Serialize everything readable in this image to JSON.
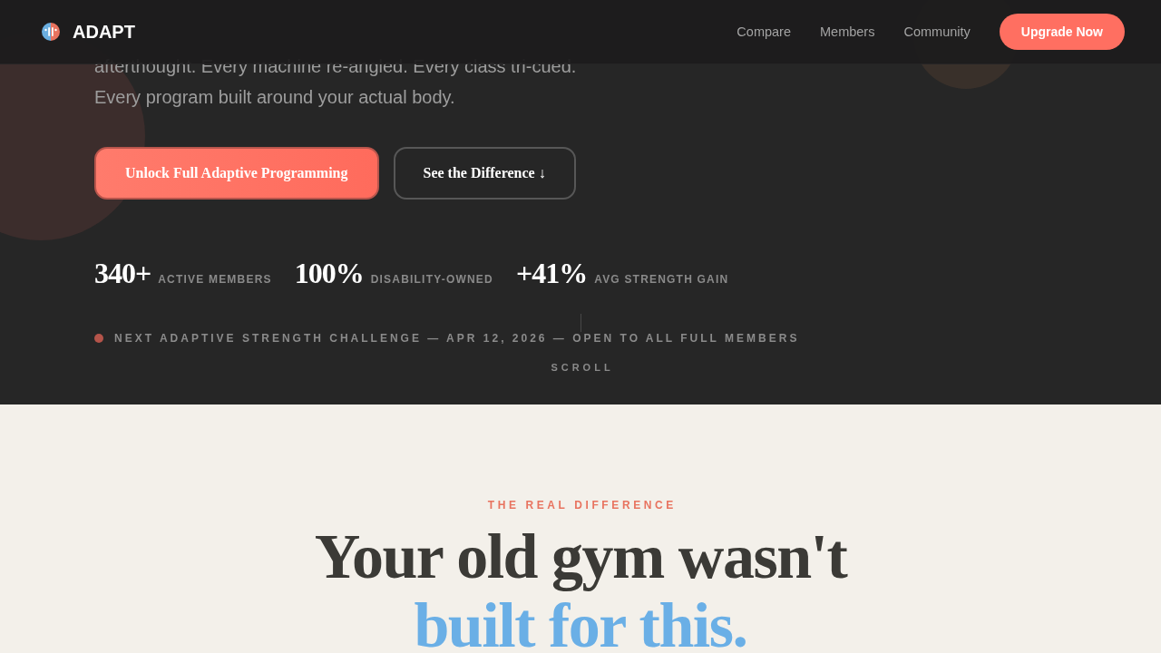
{
  "header": {
    "brand": "ADAPT",
    "nav": [
      "Compare",
      "Members",
      "Community"
    ],
    "cta": "Upgrade Now"
  },
  "hero": {
    "intro": "afterthought. Every machine re-angled. Every class tri-cued. Every program built around your actual body.",
    "buttons": [
      {
        "label": "Unlock Full Adaptive Programming",
        "kind": "primary"
      },
      {
        "label": "See the Difference ↓",
        "kind": "secondary"
      }
    ],
    "stats": [
      {
        "value": "340+",
        "label": "ACTIVE MEMBERS"
      },
      {
        "value": "100%",
        "label": "DISABILITY-OWNED"
      },
      {
        "value": "+41%",
        "label": "AVG STRENGTH GAIN"
      }
    ],
    "announcement": "NEXT ADAPTIVE STRENGTH CHALLENGE — APR 12, 2026 — OPEN TO ALL FULL MEMBERS",
    "scroll_hint": "SCROLL"
  },
  "difference": {
    "eyebrow": "THE REAL DIFFERENCE",
    "heading": "Your old gym wasn't",
    "heading_highlight": "built for this."
  }
}
